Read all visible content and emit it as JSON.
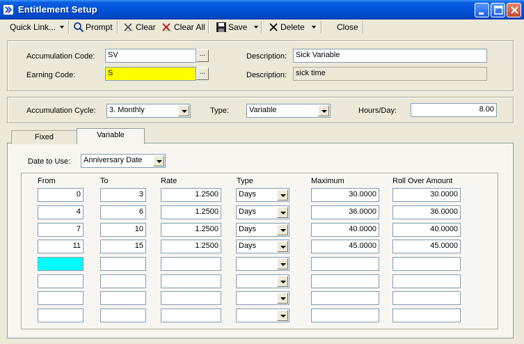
{
  "window": {
    "title": "Entitlement Setup"
  },
  "toolbar": {
    "quick_link": "Quick Link...",
    "prompt": "Prompt",
    "clear": "Clear",
    "clear_all": "Clear All",
    "save": "Save",
    "delete": "Delete",
    "close": "Close"
  },
  "codes": {
    "accumulation_code_label": "Accumulation Code:",
    "accumulation_code_value": "SV",
    "earning_code_label": "Earning Code:",
    "earning_code_value": "S",
    "description_label_1": "Description:",
    "description_value_1": "Sick Variable",
    "description_label_2": "Description:",
    "description_value_2": "sick time"
  },
  "cycle": {
    "accumulation_cycle_label": "Accumulation Cycle:",
    "accumulation_cycle_value": "3.  Monthly",
    "type_label": "Type:",
    "type_value": "Variable",
    "hours_per_day_label": "Hours/Day:",
    "hours_per_day_value": "8.00"
  },
  "tabs": [
    {
      "label": "Fixed",
      "active": false
    },
    {
      "label": "Variable",
      "active": true
    }
  ],
  "variable": {
    "date_to_use_label": "Date to Use:",
    "date_to_use_value": "Anniversary Date",
    "headers": {
      "from": "From",
      "to": "To",
      "rate": "Rate",
      "type": "Type",
      "maximum": "Maximum",
      "roll_over": "Roll Over Amount"
    },
    "rows": [
      {
        "from": "0",
        "to": "3",
        "rate": "1.2500",
        "type": "Days",
        "maximum": "30.0000",
        "roll_over": "30.0000"
      },
      {
        "from": "4",
        "to": "6",
        "rate": "1.2500",
        "type": "Days",
        "maximum": "36.0000",
        "roll_over": "36.0000"
      },
      {
        "from": "7",
        "to": "10",
        "rate": "1.2500",
        "type": "Days",
        "maximum": "40.0000",
        "roll_over": "40.0000"
      },
      {
        "from": "11",
        "to": "15",
        "rate": "1.2500",
        "type": "Days",
        "maximum": "45.0000",
        "roll_over": "45.0000"
      },
      {
        "from": "",
        "to": "",
        "rate": "",
        "type": "",
        "maximum": "",
        "roll_over": ""
      },
      {
        "from": "",
        "to": "",
        "rate": "",
        "type": "",
        "maximum": "",
        "roll_over": ""
      },
      {
        "from": "",
        "to": "",
        "rate": "",
        "type": "",
        "maximum": "",
        "roll_over": ""
      },
      {
        "from": "",
        "to": "",
        "rate": "",
        "type": "",
        "maximum": "",
        "roll_over": ""
      }
    ]
  },
  "colors": {
    "title_bar": "#0052d9",
    "required_field": "#ffff00",
    "focused_field": "#00ffff"
  }
}
